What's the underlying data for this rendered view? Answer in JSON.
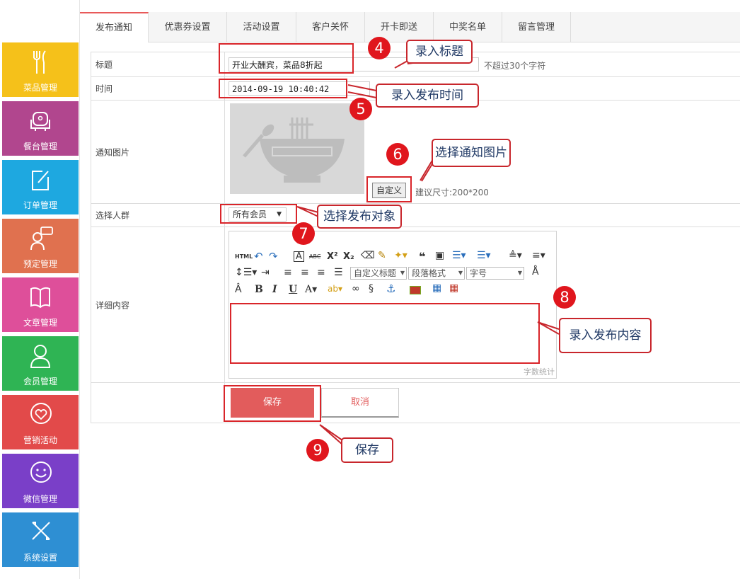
{
  "sidebar": {
    "items": [
      {
        "label": "菜品管理",
        "icon": "fork-knife-icon",
        "color": "#f5c11a"
      },
      {
        "label": "餐台管理",
        "icon": "armchair-icon",
        "color": "#b1468e"
      },
      {
        "label": "订单管理",
        "icon": "edit-note-icon",
        "color": "#1ea8e0"
      },
      {
        "label": "预定管理",
        "icon": "person-chat-icon",
        "color": "#e0714f"
      },
      {
        "label": "文章管理",
        "icon": "book-icon",
        "color": "#de4f9a"
      },
      {
        "label": "会员管理",
        "icon": "user-icon",
        "color": "#2fb454"
      },
      {
        "label": "营销活动",
        "icon": "heart-bubble-icon",
        "color": "#e24a4a"
      },
      {
        "label": "微信管理",
        "icon": "smile-icon",
        "color": "#7a3fc8"
      },
      {
        "label": "系统设置",
        "icon": "tools-icon",
        "color": "#2e8fd3"
      }
    ]
  },
  "tabs": [
    "发布通知",
    "优惠券设置",
    "活动设置",
    "客户关怀",
    "开卡即送",
    "中奖名单",
    "留言管理"
  ],
  "form": {
    "title_label": "标题",
    "title_value": "开业大酬宾，菜品8折起",
    "title_hint": "不超过30个字符",
    "time_label": "时间",
    "time_value": "2014-09-19 10:40:42",
    "image_label": "通知图片",
    "custom_button": "自定义",
    "size_hint": "建议尺寸:200*200",
    "audience_label": "选择人群",
    "audience_value": "所有会员",
    "content_label": "详细内容",
    "editor": {
      "html_btn": "HTML",
      "custom_title": "自定义标题",
      "paragraph": "段落格式",
      "font_size": "字号",
      "word_count": "字数统计"
    },
    "save": "保存",
    "cancel": "取消"
  },
  "annotations": [
    {
      "num": "4",
      "text": "录入标题"
    },
    {
      "num": "5",
      "text": "录入发布时间"
    },
    {
      "num": "6",
      "text": "选择通知图片"
    },
    {
      "num": "7",
      "text": "选择发布对象"
    },
    {
      "num": "8",
      "text": "录入发布内容"
    },
    {
      "num": "9",
      "text": "保存"
    }
  ],
  "colors": {
    "accent": "#e25c5c",
    "annotation": "#d9252a"
  }
}
